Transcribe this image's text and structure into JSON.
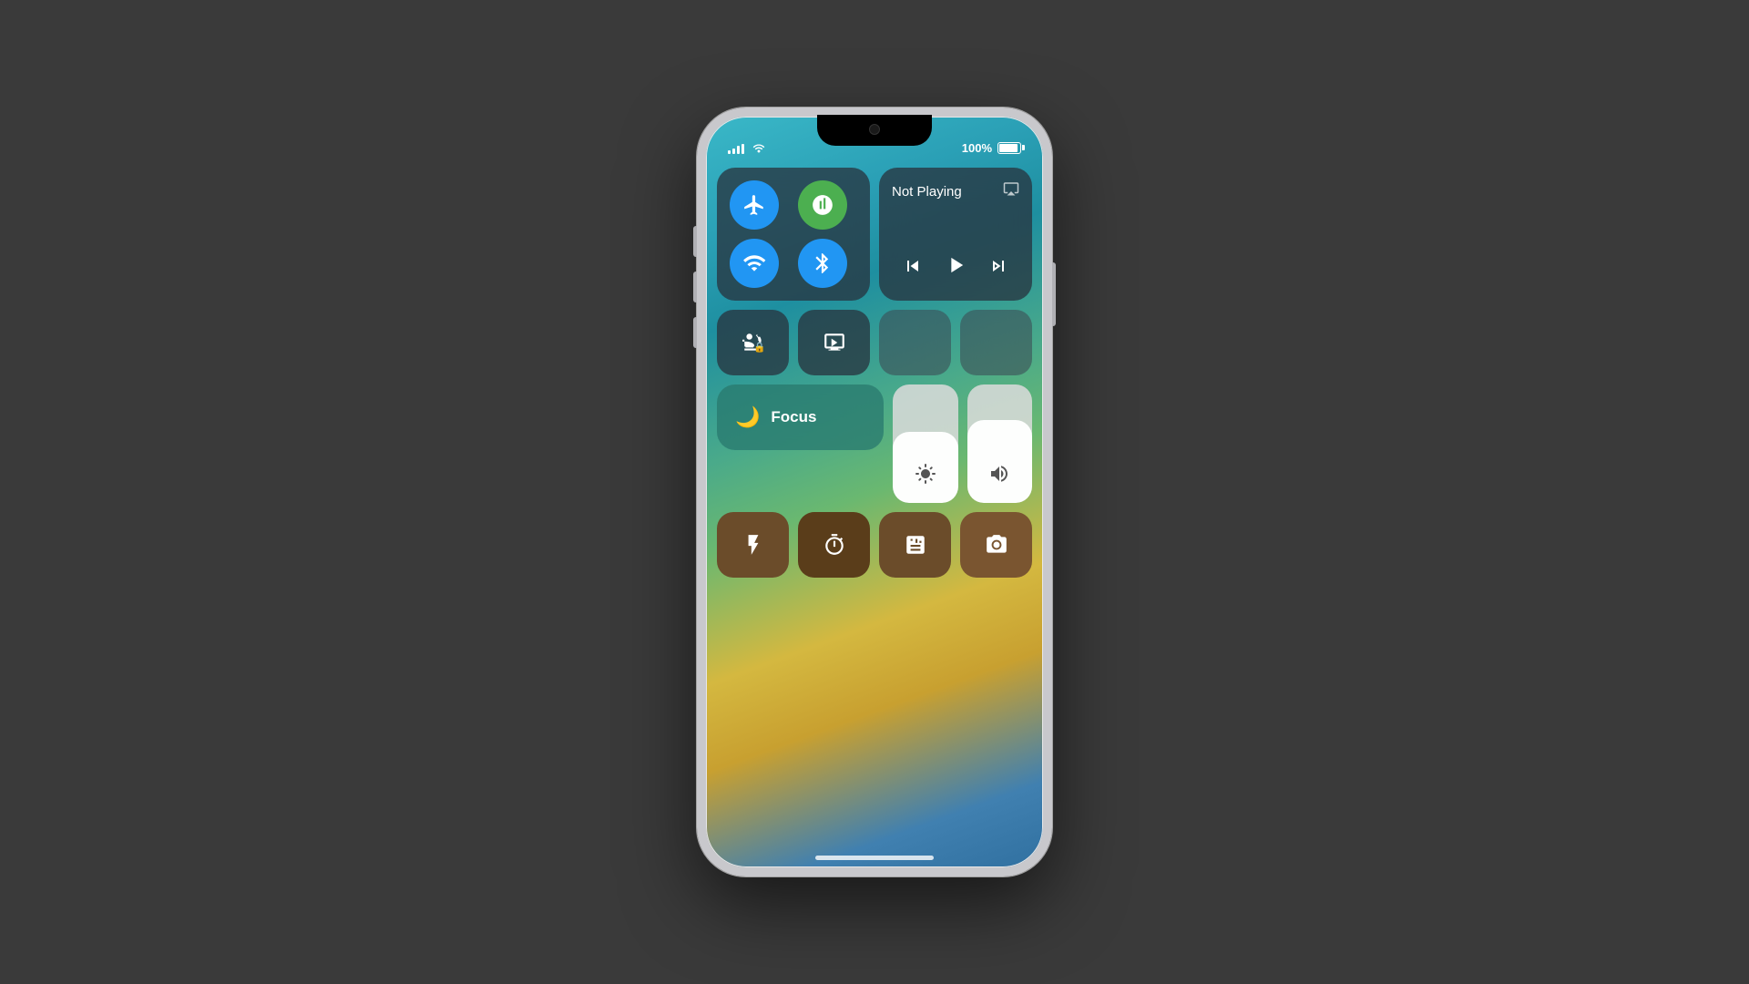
{
  "phone": {
    "status": {
      "battery_percent": "100%",
      "signal_bars": [
        4,
        6,
        9,
        11,
        14
      ],
      "wifi": true
    },
    "control_center": {
      "connectivity": {
        "airplane_mode": {
          "active": true,
          "label": "Airplane Mode"
        },
        "cellular": {
          "active": true,
          "label": "Cellular"
        },
        "wifi": {
          "active": true,
          "label": "Wi-Fi"
        },
        "bluetooth": {
          "active": true,
          "label": "Bluetooth"
        }
      },
      "now_playing": {
        "title": "Not Playing",
        "airplay_label": "AirPlay"
      },
      "media_controls": {
        "rewind": "⏮",
        "play": "▶",
        "forward": "⏭"
      },
      "row2": [
        {
          "id": "orientation-lock",
          "label": "Orientation Lock"
        },
        {
          "id": "screen-mirror",
          "label": "Screen Mirror"
        },
        {
          "id": "brightness-top",
          "label": "Brightness"
        },
        {
          "id": "volume-top",
          "label": "Volume"
        }
      ],
      "focus": {
        "label": "Focus",
        "mode": "Do Not Disturb"
      },
      "brightness": {
        "level": 60,
        "label": "Brightness"
      },
      "volume": {
        "level": 70,
        "label": "Volume"
      },
      "app_shortcuts": [
        {
          "id": "flashlight",
          "label": "Flashlight"
        },
        {
          "id": "timer",
          "label": "Timer"
        },
        {
          "id": "calculator",
          "label": "Calculator"
        },
        {
          "id": "camera",
          "label": "Camera"
        }
      ]
    }
  }
}
